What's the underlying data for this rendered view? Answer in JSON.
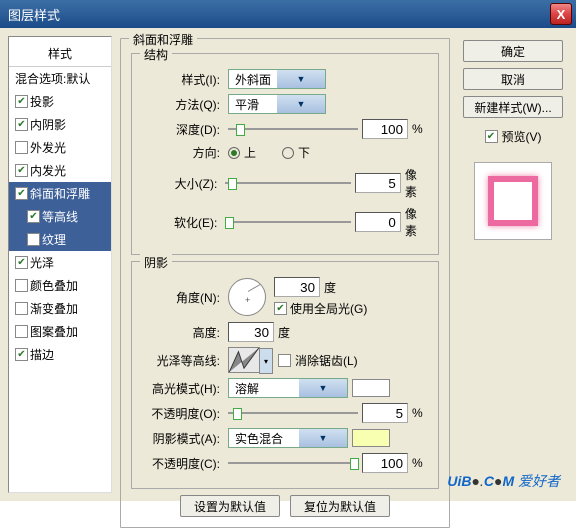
{
  "title": "图层样式",
  "close_icon": "X",
  "left": {
    "header": "样式",
    "blend_default": "混合选项:默认",
    "drop_shadow": "投影",
    "inner_shadow": "内阴影",
    "outer_glow": "外发光",
    "inner_glow": "内发光",
    "bevel_emboss": "斜面和浮雕",
    "contour": "等高线",
    "texture": "纹理",
    "satin": "光泽",
    "color_overlay": "颜色叠加",
    "gradient_overlay": "渐变叠加",
    "pattern_overlay": "图案叠加",
    "stroke": "描边"
  },
  "mid": {
    "group_title": "斜面和浮雕",
    "structure_title": "结构",
    "style_label": "样式(I):",
    "style_value": "外斜面",
    "technique_label": "方法(Q):",
    "technique_value": "平滑",
    "depth_label": "深度(D):",
    "depth_value": "100",
    "depth_unit": "%",
    "direction_label": "方向:",
    "direction_up": "上",
    "direction_down": "下",
    "size_label": "大小(Z):",
    "size_value": "5",
    "size_unit": "像素",
    "soften_label": "软化(E):",
    "soften_value": "0",
    "soften_unit": "像素",
    "shading_title": "阴影",
    "angle_label": "角度(N):",
    "angle_value": "30",
    "angle_unit": "度",
    "global_light": "使用全局光(G)",
    "altitude_label": "高度:",
    "altitude_value": "30",
    "altitude_unit": "度",
    "gloss_label": "光泽等高线:",
    "antialias": "消除锯齿(L)",
    "highlight_mode_label": "高光模式(H):",
    "highlight_mode_value": "溶解",
    "highlight_opacity_label": "不透明度(O):",
    "highlight_opacity_value": "5",
    "highlight_opacity_unit": "%",
    "shadow_mode_label": "阴影模式(A):",
    "shadow_mode_value": "实色混合",
    "shadow_opacity_label": "不透明度(C):",
    "shadow_opacity_value": "100",
    "shadow_opacity_unit": "%",
    "make_default": "设置为默认值",
    "reset_default": "复位为默认值"
  },
  "right": {
    "ok": "确定",
    "cancel": "取消",
    "new_style": "新建样式(W)...",
    "preview": "预览(V)"
  },
  "colors": {
    "highlight": "#ffffff",
    "shadow": "#f8ffb0"
  },
  "watermark": {
    "a": "UiB",
    "b": "C",
    "c": "M",
    "d": "爱好者"
  }
}
